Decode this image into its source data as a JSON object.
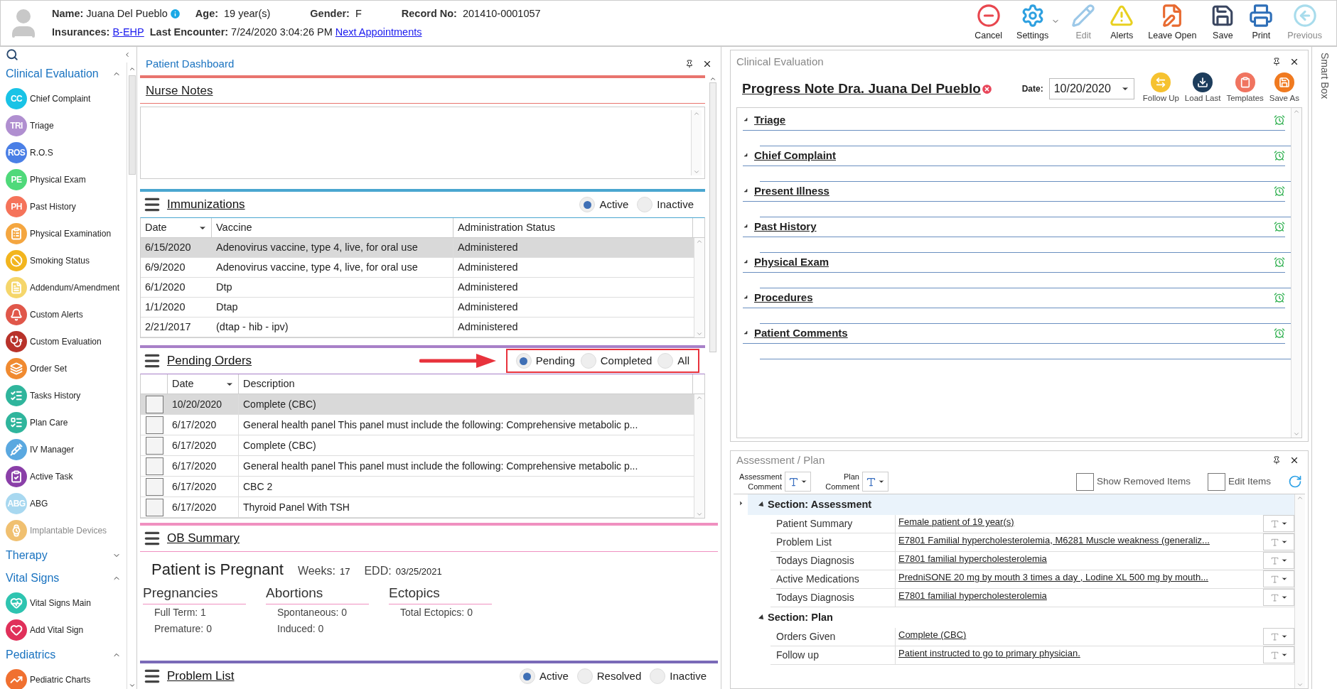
{
  "header": {
    "name_label": "Name:",
    "name": "Juana Del Pueblo",
    "age_label": "Age:",
    "age": "19 year(s)",
    "gender_label": "Gender:",
    "gender": "F",
    "record_label": "Record No:",
    "record": "201410-0001057",
    "insurances_label": "Insurances:",
    "insurance": "B-EHP",
    "last_encounter_label": "Last Encounter:",
    "last_encounter": "7/24/2020 3:04:26 PM",
    "appointments_link": "Next Appointments"
  },
  "toolbar": [
    {
      "label": "Cancel",
      "disabled": false
    },
    {
      "label": "Settings",
      "disabled": false,
      "dropdown": true
    },
    {
      "label": "Edit",
      "disabled": true
    },
    {
      "label": "Alerts",
      "disabled": false
    },
    {
      "label": "Leave Open",
      "disabled": false
    },
    {
      "label": "Save",
      "disabled": false
    },
    {
      "label": "Print",
      "disabled": false
    },
    {
      "label": "Previous",
      "disabled": true
    }
  ],
  "sidebar": {
    "groups": [
      {
        "title": "Clinical Evaluation",
        "expanded": true,
        "items": [
          {
            "label": "Chief Complaint",
            "kind": "badge",
            "badge": "CC",
            "color": "#19c3e6",
            "disabled": false
          },
          {
            "label": "Triage",
            "kind": "badge",
            "badge": "TRI",
            "color": "#b08fd0",
            "disabled": false
          },
          {
            "label": "R.O.S",
            "kind": "badge",
            "badge": "ROS",
            "color": "#4a7fe6",
            "disabled": false
          },
          {
            "label": "Physical Exam",
            "kind": "badge",
            "badge": "PE",
            "color": "#4fd97a",
            "disabled": false
          },
          {
            "label": "Past History",
            "kind": "badge",
            "badge": "PH",
            "color": "#f5735a",
            "disabled": false
          },
          {
            "label": "Physical Examination",
            "kind": "icon",
            "color": "#f4a640",
            "disabled": false
          },
          {
            "label": "Smoking Status",
            "kind": "icon",
            "color": "#f2b51e",
            "disabled": false
          },
          {
            "label": "Addendum/Amendment",
            "kind": "icon",
            "color": "#f5d66b",
            "disabled": false
          },
          {
            "label": "Custom Alerts",
            "kind": "icon",
            "color": "#e0574a",
            "disabled": false
          },
          {
            "label": "Custom Evaluation",
            "kind": "icon",
            "color": "#b8322a",
            "disabled": false
          },
          {
            "label": "Order Set",
            "kind": "icon",
            "color": "#f08a30",
            "disabled": false
          },
          {
            "label": "Tasks History",
            "kind": "icon",
            "color": "#2fb59c",
            "disabled": false
          },
          {
            "label": "Plan Care",
            "kind": "icon",
            "color": "#2fb59c",
            "disabled": false
          },
          {
            "label": "IV Manager",
            "kind": "icon",
            "color": "#5aa8e0",
            "disabled": false
          },
          {
            "label": "Active Task",
            "kind": "icon",
            "color": "#8a3fa8",
            "disabled": false
          },
          {
            "label": "ABG",
            "kind": "badge",
            "badge": "ABG",
            "color": "#a8d8f0",
            "disabled": false
          },
          {
            "label": "Implantable Devices",
            "kind": "icon",
            "color": "#f0c070",
            "disabled": true
          }
        ]
      },
      {
        "title": "Therapy",
        "expanded": false
      },
      {
        "title": "Vital Signs",
        "expanded": true,
        "items": [
          {
            "label": "Vital Signs Main",
            "kind": "icon",
            "color": "#2ec4b0",
            "disabled": false
          },
          {
            "label": "Add Vital Sign",
            "kind": "icon",
            "color": "#e0305a",
            "disabled": false
          }
        ]
      },
      {
        "title": "Pediatrics",
        "expanded": true,
        "items": [
          {
            "label": "Pediatric Charts",
            "kind": "icon",
            "color": "#f07030",
            "disabled": false
          }
        ]
      }
    ]
  },
  "dashboard": {
    "title": "Patient Dashboard",
    "nurse_notes": {
      "title": "Nurse Notes"
    },
    "immunizations": {
      "title": "Immunizations",
      "filters": [
        {
          "label": "Active",
          "selected": true
        },
        {
          "label": "Inactive",
          "selected": false
        }
      ],
      "columns": [
        "Date",
        "Vaccine",
        "Administration Status"
      ],
      "rows": [
        {
          "selected": true,
          "cells": [
            "6/15/2020",
            "Adenovirus vaccine, type 4, live, for oral use",
            "Administered"
          ]
        },
        {
          "selected": false,
          "cells": [
            "6/9/2020",
            "Adenovirus vaccine, type 4, live, for oral use",
            "Administered"
          ]
        },
        {
          "selected": false,
          "cells": [
            "6/1/2020",
            "Dtp",
            "Administered"
          ]
        },
        {
          "selected": false,
          "cells": [
            "1/1/2020",
            "Dtap",
            "Administered"
          ]
        },
        {
          "selected": false,
          "cells": [
            "2/21/2017",
            "(dtap - hib - ipv)",
            "Administered"
          ]
        }
      ]
    },
    "pending_orders": {
      "title": "Pending Orders",
      "filters": [
        {
          "label": "Pending",
          "selected": true
        },
        {
          "label": "Completed",
          "selected": false
        },
        {
          "label": "All",
          "selected": false
        }
      ],
      "columns": [
        "Date",
        "Description"
      ],
      "rows": [
        {
          "selected": true,
          "checked": false,
          "cells": [
            "10/20/2020",
            "Complete (CBC)"
          ]
        },
        {
          "selected": false,
          "checked": false,
          "cells": [
            "6/17/2020",
            "General health panel This panel must include the following: Comprehensive metabolic p..."
          ]
        },
        {
          "selected": false,
          "checked": false,
          "cells": [
            "6/17/2020",
            "Complete (CBC)"
          ]
        },
        {
          "selected": false,
          "checked": false,
          "cells": [
            "6/17/2020",
            "General health panel This panel must include the following: Comprehensive metabolic p..."
          ]
        },
        {
          "selected": false,
          "checked": false,
          "cells": [
            "6/17/2020",
            "CBC 2"
          ]
        },
        {
          "selected": false,
          "checked": false,
          "cells": [
            "6/17/2020",
            "Thyroid Panel With TSH"
          ]
        }
      ]
    },
    "ob_summary": {
      "title": "OB Summary",
      "status": "Patient is Pregnant",
      "weeks_label": "Weeks:",
      "weeks": "17",
      "edd_label": "EDD:",
      "edd": "03/25/2021",
      "groups": [
        {
          "title": "Pregnancies",
          "lines": [
            "Full Term: 1",
            "Premature: 0"
          ]
        },
        {
          "title": "Abortions",
          "lines": [
            "Spontaneous: 0",
            "Induced: 0"
          ]
        },
        {
          "title": "Ectopics",
          "lines": [
            "Total Ectopics: 0"
          ]
        }
      ]
    },
    "problem_list": {
      "title": "Problem List",
      "filters": [
        {
          "label": "Active",
          "selected": true
        },
        {
          "label": "Resolved",
          "selected": false
        },
        {
          "label": "Inactive",
          "selected": false
        }
      ]
    }
  },
  "clinical_evaluation": {
    "title": "Clinical Evaluation",
    "note_title": "Progress Note Dra. Juana Del Pueblo",
    "date_label": "Date:",
    "date": "10/20/2020",
    "actions": [
      "Follow Up",
      "Load Last",
      "Templates",
      "Save As"
    ],
    "sections": [
      {
        "title": "Triage",
        "expanded": true
      },
      {
        "title": "Chief Complaint",
        "expanded": true
      },
      {
        "title": "Present Illness",
        "expanded": true
      },
      {
        "title": "Past History",
        "expanded": true
      },
      {
        "title": "Physical Exam",
        "expanded": true
      },
      {
        "title": "Procedures",
        "expanded": true
      },
      {
        "title": "Patient Comments",
        "expanded": true
      }
    ]
  },
  "assessment_plan": {
    "title": "Assessment / Plan",
    "assessment_comment_label": "Assessment Comment",
    "plan_comment_label": "Plan Comment",
    "options": [
      {
        "label": "Show Removed Items",
        "checked": false
      },
      {
        "label": "Edit Items",
        "checked": false
      }
    ],
    "sections": [
      {
        "title": "Section: Assessment",
        "expanded": true,
        "selected": true,
        "rows": [
          {
            "label": "Patient Summary",
            "value": "Female patient of 19 year(s)"
          },
          {
            "label": "Problem List",
            "value": "E7801 Familial hypercholesterolemia, M6281 Muscle weakness (generaliz..."
          },
          {
            "label": "Todays Diagnosis",
            "value": "E7801 familial hypercholesterolemia"
          },
          {
            "label": "Active Medications",
            "value": "PredniSONE 20 mg by mouth 3 times a day , Lodine XL 500 mg by mouth..."
          },
          {
            "label": "Todays Diagnosis",
            "value": "E7801 familial hypercholesterolemia"
          }
        ]
      },
      {
        "title": "Section: Plan",
        "expanded": true,
        "selected": false,
        "rows": [
          {
            "label": "Orders Given",
            "value": "Complete (CBC)"
          },
          {
            "label": "Follow up",
            "value": "Patient instructed to go to primary physician."
          }
        ]
      }
    ]
  },
  "smart_box": {
    "title": "Smart Box"
  }
}
